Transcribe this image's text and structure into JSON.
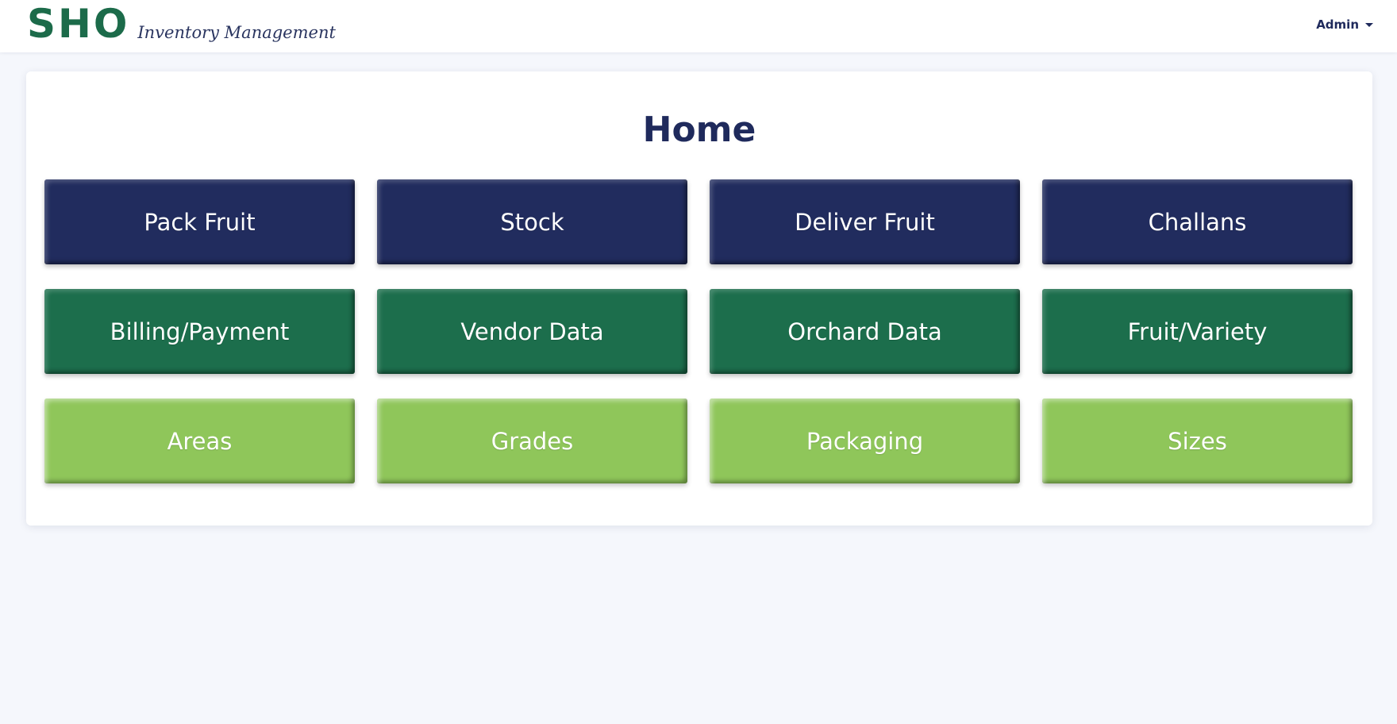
{
  "header": {
    "logo_mark": "SHO",
    "logo_subtitle": "Inventory Management",
    "user_label": "Admin"
  },
  "main": {
    "title": "Home",
    "tiles": [
      {
        "label": "Pack Fruit",
        "color": "#212c5e"
      },
      {
        "label": "Stock",
        "color": "#212c5e"
      },
      {
        "label": "Deliver Fruit",
        "color": "#212c5e"
      },
      {
        "label": "Challans",
        "color": "#212c5e"
      },
      {
        "label": "Billing/Payment",
        "color": "#1c6e4c"
      },
      {
        "label": "Vendor Data",
        "color": "#1c6e4c"
      },
      {
        "label": "Orchard Data",
        "color": "#1c6e4c"
      },
      {
        "label": "Fruit/Variety",
        "color": "#1c6e4c"
      },
      {
        "label": "Areas",
        "color": "#8fc65a"
      },
      {
        "label": "Grades",
        "color": "#8fc65a"
      },
      {
        "label": "Packaging",
        "color": "#8fc65a"
      },
      {
        "label": "Sizes",
        "color": "#8fc65a"
      }
    ]
  },
  "colors": {
    "primary_navy": "#1f2a5c",
    "brand_green": "#1c6b4a",
    "lime": "#8fc65a",
    "background": "#f5f7fc"
  }
}
